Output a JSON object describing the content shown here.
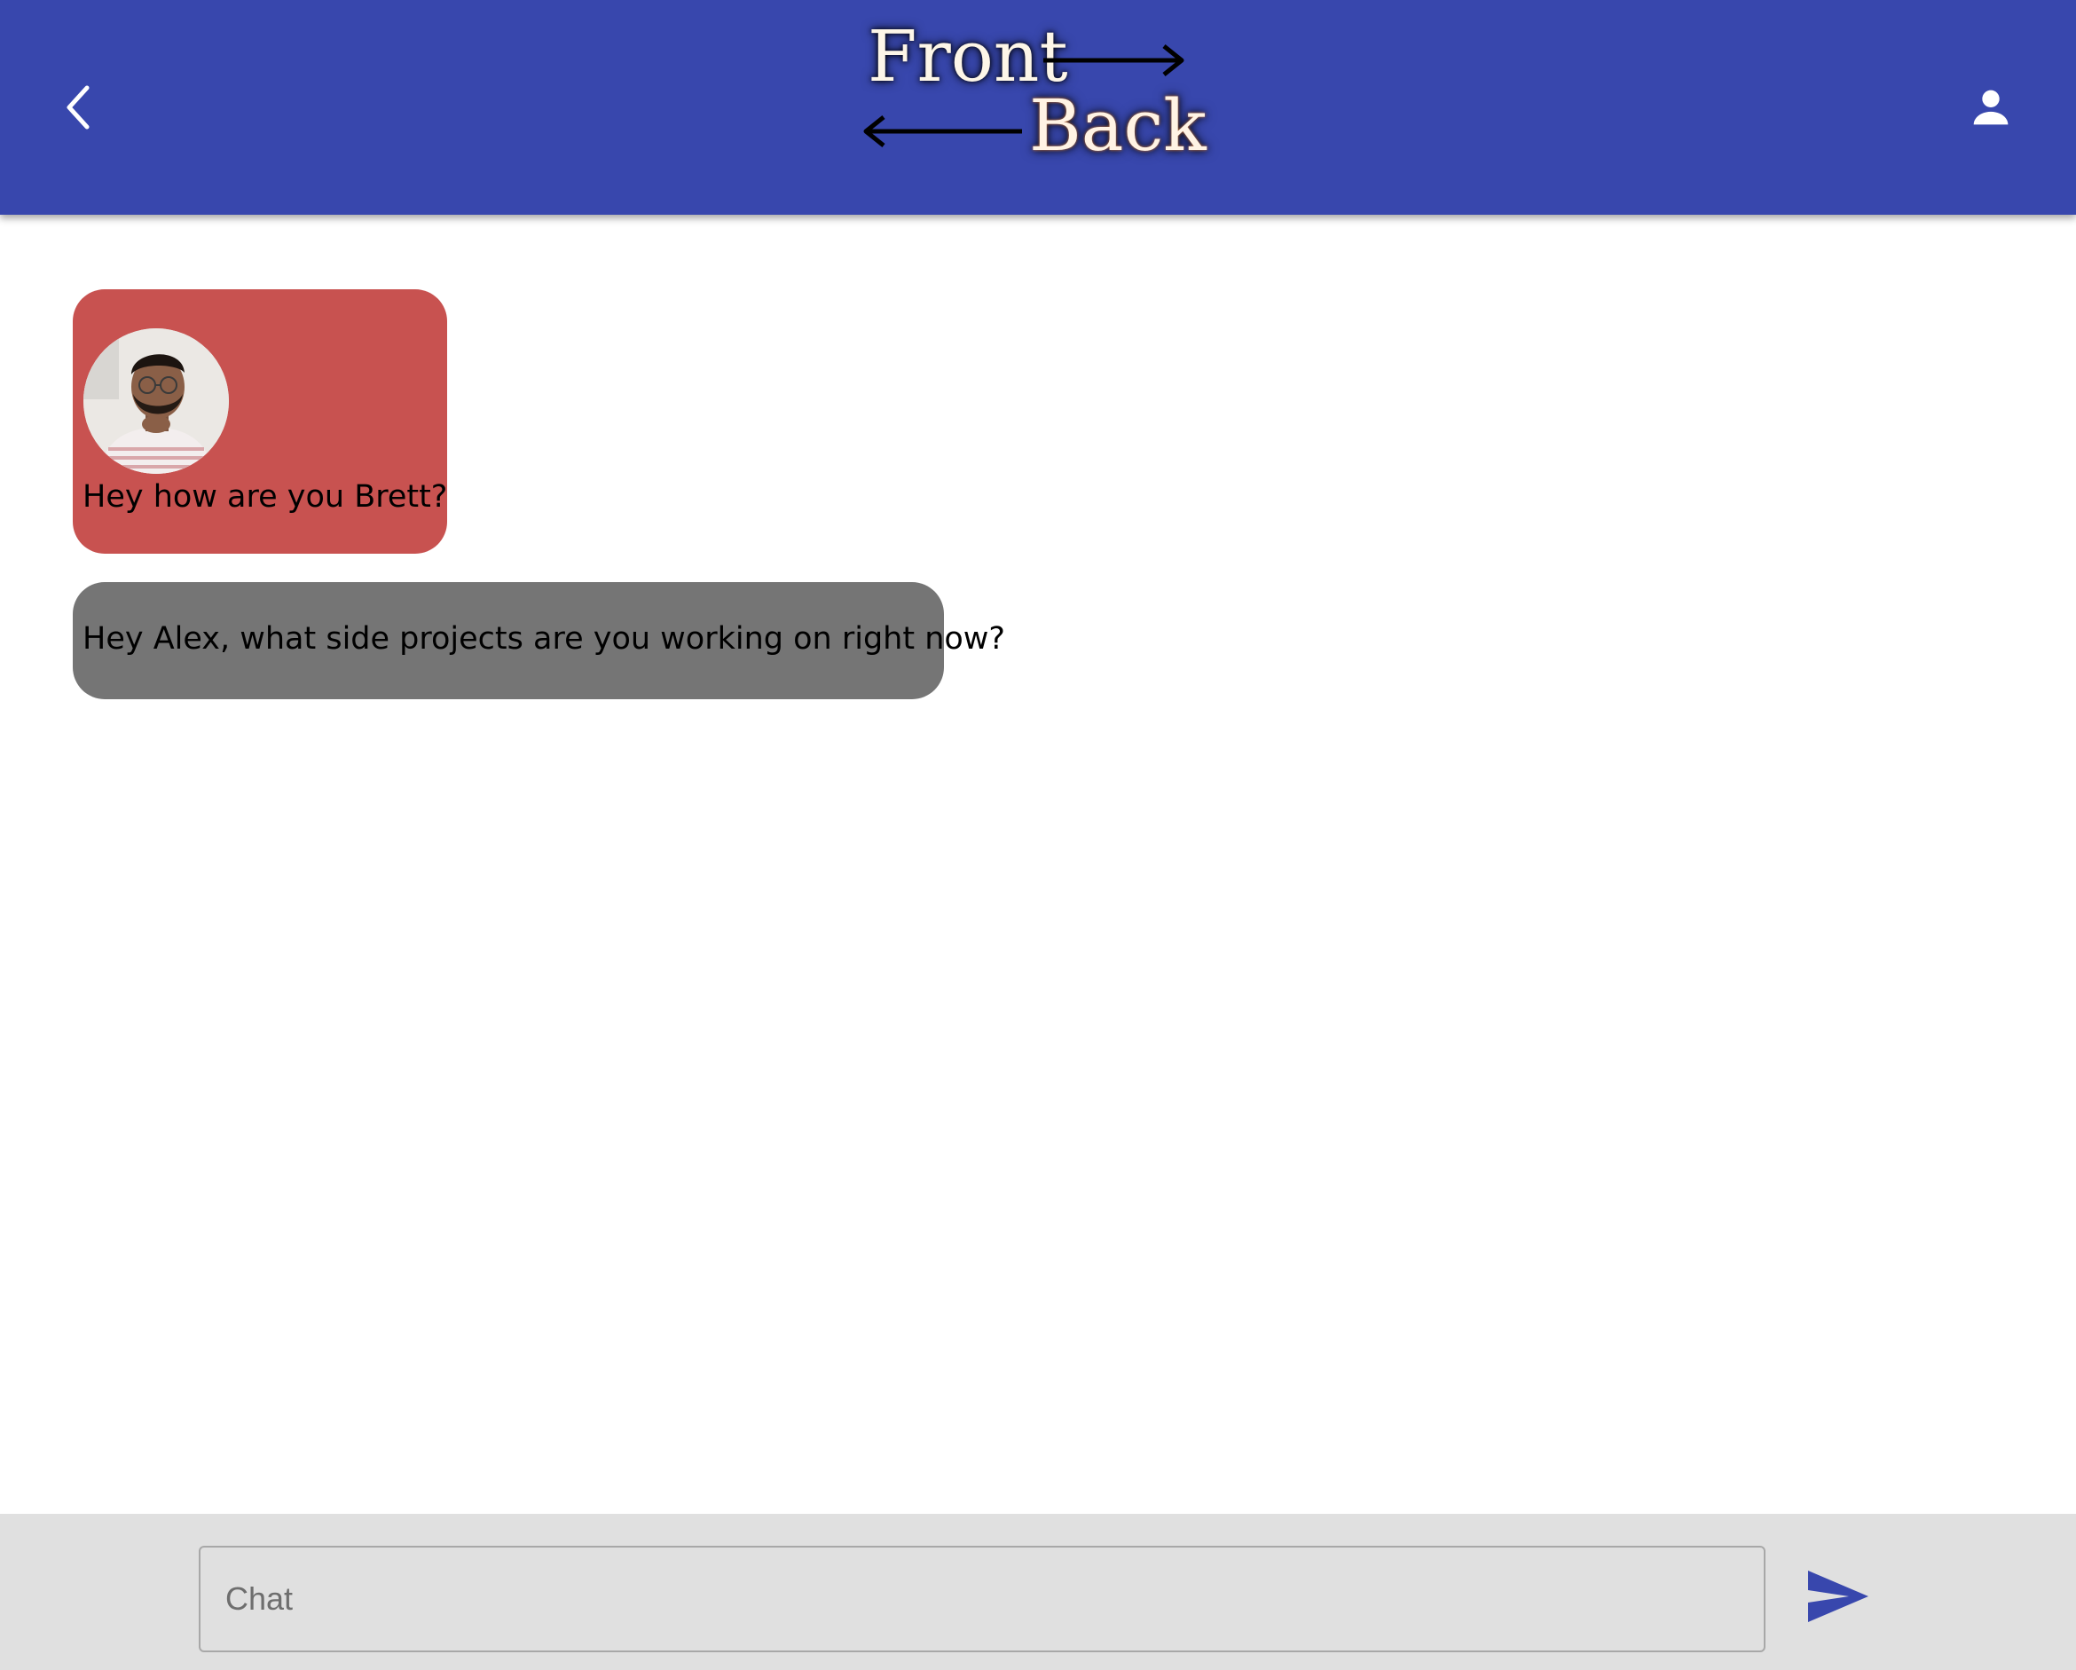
{
  "header": {
    "logo_front": "Front",
    "logo_back": "Back",
    "back_icon": "chevron-left-icon",
    "profile_icon": "person-icon",
    "background_color": "#3847ad"
  },
  "messages": [
    {
      "text": "Hey how are you Brett?",
      "has_avatar": true,
      "bubble_color": "#c85250"
    },
    {
      "text": "Hey Alex, what side projects are you working on right now?",
      "has_avatar": false,
      "bubble_color": "#757575"
    }
  ],
  "composer": {
    "placeholder": "Chat",
    "value": "",
    "send_icon": "send-icon",
    "accent_color": "#3847ad"
  }
}
